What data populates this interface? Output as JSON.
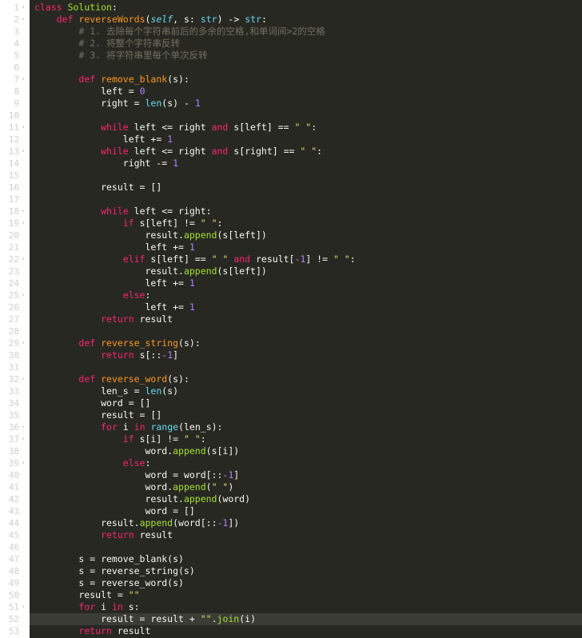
{
  "editor": {
    "language": "Python",
    "theme": "monokai-dark",
    "colors": {
      "background": "#272822",
      "gutter_background": "#ffffff",
      "gutter_text": "#cfcfcf",
      "active_line": "#3b3c35",
      "keyword": "#f92672",
      "function_name": "#fd971f",
      "builtin": "#66d9ef",
      "method": "#a6e22e",
      "number": "#ae81ff",
      "string": "#e6db74",
      "comment": "#75715e",
      "text": "#f8f8f2"
    },
    "active_line_number": 52,
    "total_lines": 53
  },
  "lines": [
    {
      "n": 1,
      "fold": true,
      "tokens": [
        {
          "t": "kw",
          "v": "class"
        },
        {
          "t": "pl",
          "v": " "
        },
        {
          "t": "cls",
          "v": "Solution"
        },
        {
          "t": "pl",
          "v": ":"
        }
      ]
    },
    {
      "n": 2,
      "fold": true,
      "tokens": [
        {
          "t": "pl",
          "v": "    "
        },
        {
          "t": "kw",
          "v": "def"
        },
        {
          "t": "pl",
          "v": " "
        },
        {
          "t": "fn",
          "v": "reverseWords"
        },
        {
          "t": "pl",
          "v": "("
        },
        {
          "t": "self",
          "v": "self"
        },
        {
          "t": "pl",
          "v": ", s: "
        },
        {
          "t": "type",
          "v": "str"
        },
        {
          "t": "pl",
          "v": ") -> "
        },
        {
          "t": "type",
          "v": "str"
        },
        {
          "t": "pl",
          "v": ":"
        }
      ]
    },
    {
      "n": 3,
      "fold": false,
      "tokens": [
        {
          "t": "pl",
          "v": "        "
        },
        {
          "t": "com",
          "v": "# 1. 去除每个字符串前后的多余的空格,和单词间>2的空格"
        }
      ]
    },
    {
      "n": 4,
      "fold": false,
      "tokens": [
        {
          "t": "pl",
          "v": "        "
        },
        {
          "t": "com",
          "v": "# 2. 将整个字符串反转"
        }
      ]
    },
    {
      "n": 5,
      "fold": false,
      "tokens": [
        {
          "t": "pl",
          "v": "        "
        },
        {
          "t": "com",
          "v": "# 3. 将字符串里每个单次反转"
        }
      ]
    },
    {
      "n": 6,
      "fold": false,
      "tokens": []
    },
    {
      "n": 7,
      "fold": true,
      "tokens": [
        {
          "t": "pl",
          "v": "        "
        },
        {
          "t": "kw",
          "v": "def"
        },
        {
          "t": "pl",
          "v": " "
        },
        {
          "t": "fn",
          "v": "remove_blank"
        },
        {
          "t": "pl",
          "v": "(s):"
        }
      ]
    },
    {
      "n": 8,
      "fold": false,
      "tokens": [
        {
          "t": "pl",
          "v": "            left = "
        },
        {
          "t": "num",
          "v": "0"
        }
      ]
    },
    {
      "n": 9,
      "fold": false,
      "tokens": [
        {
          "t": "pl",
          "v": "            right = "
        },
        {
          "t": "call",
          "v": "len"
        },
        {
          "t": "pl",
          "v": "(s) - "
        },
        {
          "t": "num",
          "v": "1"
        }
      ]
    },
    {
      "n": 10,
      "fold": false,
      "tokens": []
    },
    {
      "n": 11,
      "fold": true,
      "tokens": [
        {
          "t": "pl",
          "v": "            "
        },
        {
          "t": "kw",
          "v": "while"
        },
        {
          "t": "pl",
          "v": " left <= right "
        },
        {
          "t": "kw",
          "v": "and"
        },
        {
          "t": "pl",
          "v": " s[left] == "
        },
        {
          "t": "str",
          "v": "\" \""
        },
        {
          "t": "pl",
          "v": ":"
        }
      ]
    },
    {
      "n": 12,
      "fold": false,
      "tokens": [
        {
          "t": "pl",
          "v": "                left += "
        },
        {
          "t": "num",
          "v": "1"
        }
      ]
    },
    {
      "n": 13,
      "fold": true,
      "tokens": [
        {
          "t": "pl",
          "v": "            "
        },
        {
          "t": "kw",
          "v": "while"
        },
        {
          "t": "pl",
          "v": " left <= right "
        },
        {
          "t": "kw",
          "v": "and"
        },
        {
          "t": "pl",
          "v": " s[right] == "
        },
        {
          "t": "str",
          "v": "\" \""
        },
        {
          "t": "pl",
          "v": ":"
        }
      ]
    },
    {
      "n": 14,
      "fold": false,
      "tokens": [
        {
          "t": "pl",
          "v": "                right -= "
        },
        {
          "t": "num",
          "v": "1"
        }
      ]
    },
    {
      "n": 15,
      "fold": false,
      "tokens": []
    },
    {
      "n": 16,
      "fold": false,
      "tokens": [
        {
          "t": "pl",
          "v": "            result = []"
        }
      ]
    },
    {
      "n": 17,
      "fold": false,
      "tokens": []
    },
    {
      "n": 18,
      "fold": true,
      "tokens": [
        {
          "t": "pl",
          "v": "            "
        },
        {
          "t": "kw",
          "v": "while"
        },
        {
          "t": "pl",
          "v": " left <= right:"
        }
      ]
    },
    {
      "n": 19,
      "fold": true,
      "tokens": [
        {
          "t": "pl",
          "v": "                "
        },
        {
          "t": "kw",
          "v": "if"
        },
        {
          "t": "pl",
          "v": " s[left] != "
        },
        {
          "t": "str",
          "v": "\" \""
        },
        {
          "t": "pl",
          "v": ":"
        }
      ]
    },
    {
      "n": 20,
      "fold": false,
      "tokens": [
        {
          "t": "pl",
          "v": "                    result."
        },
        {
          "t": "meth",
          "v": "append"
        },
        {
          "t": "pl",
          "v": "(s[left])"
        }
      ]
    },
    {
      "n": 21,
      "fold": false,
      "tokens": [
        {
          "t": "pl",
          "v": "                    left += "
        },
        {
          "t": "num",
          "v": "1"
        }
      ]
    },
    {
      "n": 22,
      "fold": true,
      "tokens": [
        {
          "t": "pl",
          "v": "                "
        },
        {
          "t": "kw",
          "v": "elif"
        },
        {
          "t": "pl",
          "v": " s[left] == "
        },
        {
          "t": "str",
          "v": "\" \""
        },
        {
          "t": "pl",
          "v": " "
        },
        {
          "t": "kw",
          "v": "and"
        },
        {
          "t": "pl",
          "v": " result["
        },
        {
          "t": "num",
          "v": "-1"
        },
        {
          "t": "pl",
          "v": "] != "
        },
        {
          "t": "str",
          "v": "\" \""
        },
        {
          "t": "pl",
          "v": ":"
        }
      ]
    },
    {
      "n": 23,
      "fold": false,
      "tokens": [
        {
          "t": "pl",
          "v": "                    result."
        },
        {
          "t": "meth",
          "v": "append"
        },
        {
          "t": "pl",
          "v": "(s[left])"
        }
      ]
    },
    {
      "n": 24,
      "fold": false,
      "tokens": [
        {
          "t": "pl",
          "v": "                    left += "
        },
        {
          "t": "num",
          "v": "1"
        }
      ]
    },
    {
      "n": 25,
      "fold": true,
      "tokens": [
        {
          "t": "pl",
          "v": "                "
        },
        {
          "t": "kw",
          "v": "else"
        },
        {
          "t": "pl",
          "v": ":"
        }
      ]
    },
    {
      "n": 26,
      "fold": false,
      "tokens": [
        {
          "t": "pl",
          "v": "                    left += "
        },
        {
          "t": "num",
          "v": "1"
        }
      ]
    },
    {
      "n": 27,
      "fold": false,
      "tokens": [
        {
          "t": "pl",
          "v": "            "
        },
        {
          "t": "kw",
          "v": "return"
        },
        {
          "t": "pl",
          "v": " result"
        }
      ]
    },
    {
      "n": 28,
      "fold": false,
      "tokens": []
    },
    {
      "n": 29,
      "fold": true,
      "tokens": [
        {
          "t": "pl",
          "v": "        "
        },
        {
          "t": "kw",
          "v": "def"
        },
        {
          "t": "pl",
          "v": " "
        },
        {
          "t": "fn",
          "v": "reverse_string"
        },
        {
          "t": "pl",
          "v": "(s):"
        }
      ]
    },
    {
      "n": 30,
      "fold": false,
      "tokens": [
        {
          "t": "pl",
          "v": "            "
        },
        {
          "t": "kw",
          "v": "return"
        },
        {
          "t": "pl",
          "v": " s[::"
        },
        {
          "t": "num",
          "v": "-1"
        },
        {
          "t": "pl",
          "v": "]"
        }
      ]
    },
    {
      "n": 31,
      "fold": false,
      "tokens": []
    },
    {
      "n": 32,
      "fold": true,
      "tokens": [
        {
          "t": "pl",
          "v": "        "
        },
        {
          "t": "kw",
          "v": "def"
        },
        {
          "t": "pl",
          "v": " "
        },
        {
          "t": "fn",
          "v": "reverse_word"
        },
        {
          "t": "pl",
          "v": "(s):"
        }
      ]
    },
    {
      "n": 33,
      "fold": false,
      "tokens": [
        {
          "t": "pl",
          "v": "            len_s = "
        },
        {
          "t": "call",
          "v": "len"
        },
        {
          "t": "pl",
          "v": "(s)"
        }
      ]
    },
    {
      "n": 34,
      "fold": false,
      "tokens": [
        {
          "t": "pl",
          "v": "            word = []"
        }
      ]
    },
    {
      "n": 35,
      "fold": false,
      "tokens": [
        {
          "t": "pl",
          "v": "            result = []"
        }
      ]
    },
    {
      "n": 36,
      "fold": true,
      "tokens": [
        {
          "t": "pl",
          "v": "            "
        },
        {
          "t": "kw",
          "v": "for"
        },
        {
          "t": "pl",
          "v": " i "
        },
        {
          "t": "kw",
          "v": "in"
        },
        {
          "t": "pl",
          "v": " "
        },
        {
          "t": "call",
          "v": "range"
        },
        {
          "t": "pl",
          "v": "(len_s):"
        }
      ]
    },
    {
      "n": 37,
      "fold": true,
      "tokens": [
        {
          "t": "pl",
          "v": "                "
        },
        {
          "t": "kw",
          "v": "if"
        },
        {
          "t": "pl",
          "v": " s[i] != "
        },
        {
          "t": "str",
          "v": "\" \""
        },
        {
          "t": "pl",
          "v": ":"
        }
      ]
    },
    {
      "n": 38,
      "fold": false,
      "tokens": [
        {
          "t": "pl",
          "v": "                    word."
        },
        {
          "t": "meth",
          "v": "append"
        },
        {
          "t": "pl",
          "v": "(s[i])"
        }
      ]
    },
    {
      "n": 39,
      "fold": true,
      "tokens": [
        {
          "t": "pl",
          "v": "                "
        },
        {
          "t": "kw",
          "v": "else"
        },
        {
          "t": "pl",
          "v": ":"
        }
      ]
    },
    {
      "n": 40,
      "fold": false,
      "tokens": [
        {
          "t": "pl",
          "v": "                    word = word[::"
        },
        {
          "t": "num",
          "v": "-1"
        },
        {
          "t": "pl",
          "v": "]"
        }
      ]
    },
    {
      "n": 41,
      "fold": false,
      "tokens": [
        {
          "t": "pl",
          "v": "                    word."
        },
        {
          "t": "meth",
          "v": "append"
        },
        {
          "t": "pl",
          "v": "("
        },
        {
          "t": "str",
          "v": "\" \""
        },
        {
          "t": "pl",
          "v": ")"
        }
      ]
    },
    {
      "n": 42,
      "fold": false,
      "tokens": [
        {
          "t": "pl",
          "v": "                    result."
        },
        {
          "t": "meth",
          "v": "append"
        },
        {
          "t": "pl",
          "v": "(word)"
        }
      ]
    },
    {
      "n": 43,
      "fold": false,
      "tokens": [
        {
          "t": "pl",
          "v": "                    word = []"
        }
      ]
    },
    {
      "n": 44,
      "fold": false,
      "tokens": [
        {
          "t": "pl",
          "v": "            result."
        },
        {
          "t": "meth",
          "v": "append"
        },
        {
          "t": "pl",
          "v": "(word[::"
        },
        {
          "t": "num",
          "v": "-1"
        },
        {
          "t": "pl",
          "v": "])"
        }
      ]
    },
    {
      "n": 45,
      "fold": false,
      "tokens": [
        {
          "t": "pl",
          "v": "            "
        },
        {
          "t": "kw",
          "v": "return"
        },
        {
          "t": "pl",
          "v": " result"
        }
      ]
    },
    {
      "n": 46,
      "fold": false,
      "tokens": []
    },
    {
      "n": 47,
      "fold": false,
      "tokens": [
        {
          "t": "pl",
          "v": "        s = remove_blank(s)"
        }
      ]
    },
    {
      "n": 48,
      "fold": false,
      "tokens": [
        {
          "t": "pl",
          "v": "        s = reverse_string(s)"
        }
      ]
    },
    {
      "n": 49,
      "fold": false,
      "tokens": [
        {
          "t": "pl",
          "v": "        s = reverse_word(s)"
        }
      ]
    },
    {
      "n": 50,
      "fold": false,
      "tokens": [
        {
          "t": "pl",
          "v": "        result = "
        },
        {
          "t": "str",
          "v": "\"\""
        }
      ]
    },
    {
      "n": 51,
      "fold": true,
      "tokens": [
        {
          "t": "pl",
          "v": "        "
        },
        {
          "t": "kw",
          "v": "for"
        },
        {
          "t": "pl",
          "v": " i "
        },
        {
          "t": "kw",
          "v": "in"
        },
        {
          "t": "pl",
          "v": " s:"
        }
      ]
    },
    {
      "n": 52,
      "fold": false,
      "tokens": [
        {
          "t": "pl",
          "v": "            result = result + "
        },
        {
          "t": "str",
          "v": "\"\""
        },
        {
          "t": "pl",
          "v": "."
        },
        {
          "t": "meth",
          "v": "join"
        },
        {
          "t": "pl",
          "v": "(i)"
        }
      ]
    },
    {
      "n": 53,
      "fold": false,
      "tokens": [
        {
          "t": "pl",
          "v": "        "
        },
        {
          "t": "kw",
          "v": "return"
        },
        {
          "t": "pl",
          "v": " result"
        }
      ]
    }
  ],
  "gutter": {
    "fold_marker": "▾"
  }
}
